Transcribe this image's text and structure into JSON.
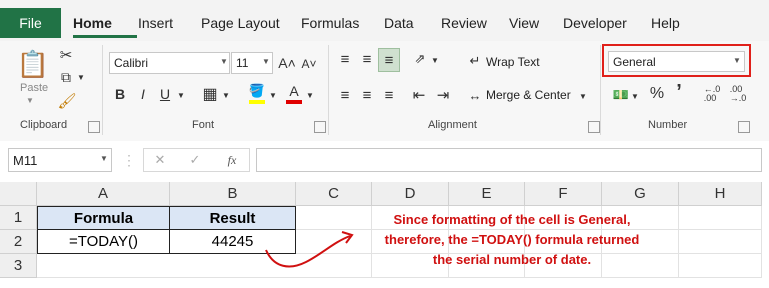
{
  "ribbon": {
    "tabs": [
      "File",
      "Home",
      "Insert",
      "Page Layout",
      "Formulas",
      "Data",
      "Review",
      "View",
      "Developer",
      "Help"
    ],
    "active_tab": "Home",
    "clipboard": {
      "paste_label": "Paste",
      "group_label": "Clipboard"
    },
    "font": {
      "name": "Calibri",
      "size": "11",
      "bold": "B",
      "italic": "I",
      "underline": "U",
      "grow": "A˄",
      "shrink": "A˅",
      "group_label": "Font",
      "fill_letter": "A",
      "font_color_letter": "A"
    },
    "alignment": {
      "wrap_text": "Wrap Text",
      "merge_center": "Merge & Center",
      "group_label": "Alignment"
    },
    "number": {
      "format": "General",
      "percent": "%",
      "comma": "’",
      "group_label": "Number"
    }
  },
  "formula_bar": {
    "name_box": "M11",
    "cancel": "✕",
    "enter": "✓",
    "fx": "fx",
    "content": ""
  },
  "grid": {
    "columns": [
      "A",
      "B",
      "C",
      "D",
      "E",
      "F",
      "G",
      "H"
    ],
    "rows": [
      "1",
      "2",
      "3"
    ],
    "header_row": [
      "Formula",
      "Result"
    ],
    "data_row": [
      "=TODAY()",
      "44245"
    ]
  },
  "annotation": {
    "lines": [
      "Since formatting of the cell is General,",
      "therefore, the =TODAY() formula returned",
      "the serial number of date."
    ]
  },
  "colors": {
    "accent": "#217346",
    "header_fill": "#dbe6f5",
    "annotation": "#d01010",
    "highlight_box": "#e0201a"
  }
}
